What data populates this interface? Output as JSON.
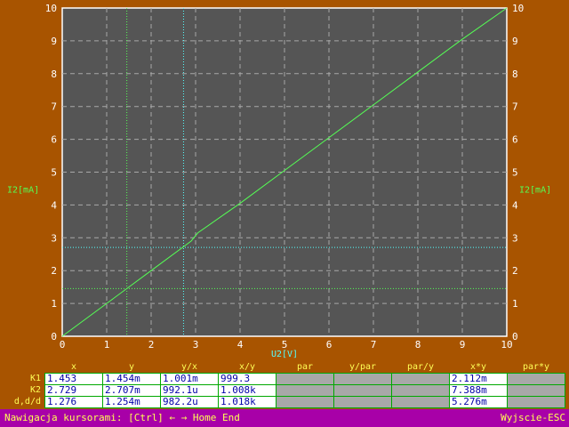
{
  "colors": {
    "background": "#a85400",
    "plot_bg": "#555555",
    "grid": "#a8a8a8",
    "trace": "#55ff55",
    "cursor1": "#55ff55",
    "cursor2": "#55ffff",
    "axis_label_x": "#55ffff",
    "axis_label_y": "#55ff55",
    "status_bg": "#a800a8",
    "status_fg": "#ffff55"
  },
  "chart_data": {
    "type": "line",
    "xlabel": "U2[V]",
    "ylabel_left": "I2[mA]",
    "ylabel_right": "I2[mA]",
    "xlim": [
      0,
      10
    ],
    "ylim": [
      0,
      10
    ],
    "xticks": [
      "0",
      "1",
      "2",
      "3",
      "4",
      "5",
      "6",
      "7",
      "8",
      "9",
      "10"
    ],
    "yticks": [
      "0",
      "1",
      "2",
      "3",
      "4",
      "5",
      "6",
      "7",
      "8",
      "9",
      "10"
    ],
    "grid": true,
    "series": [
      {
        "x": [
          0,
          1,
          2,
          2.9,
          3.05,
          4,
          5,
          6,
          7,
          8,
          9,
          10
        ],
        "y": [
          0,
          1.0,
          2.0,
          2.9,
          3.15,
          4.05,
          5.05,
          6.05,
          7.05,
          8.05,
          9.05,
          10.0
        ]
      }
    ],
    "cursors": [
      {
        "id": "K1",
        "x": 1.453,
        "y": 1.454
      },
      {
        "id": "K2",
        "x": 2.729,
        "y": 2.707
      }
    ]
  },
  "table": {
    "headers": [
      "x",
      "y",
      "y/x",
      "x/y",
      "par",
      "y/par",
      "par/y",
      "x*y",
      "par*y"
    ],
    "row_labels": [
      "K1",
      "K2",
      "d,d/d"
    ],
    "rows": [
      [
        "1.453",
        "1.454m",
        "1.001m",
        "999.3",
        "",
        "",
        "",
        "2.112m",
        ""
      ],
      [
        "2.729",
        "2.707m",
        "992.1u",
        "1.008k",
        "",
        "",
        "",
        "7.388m",
        ""
      ],
      [
        "1.276",
        "1.254m",
        "982.2u",
        "1.018k",
        "",
        "",
        "",
        "5.276m",
        ""
      ]
    ]
  },
  "status": {
    "left": "Nawigacja kursorami: [Ctrl] ← → Home End",
    "right": "Wyjscie-ESC"
  }
}
